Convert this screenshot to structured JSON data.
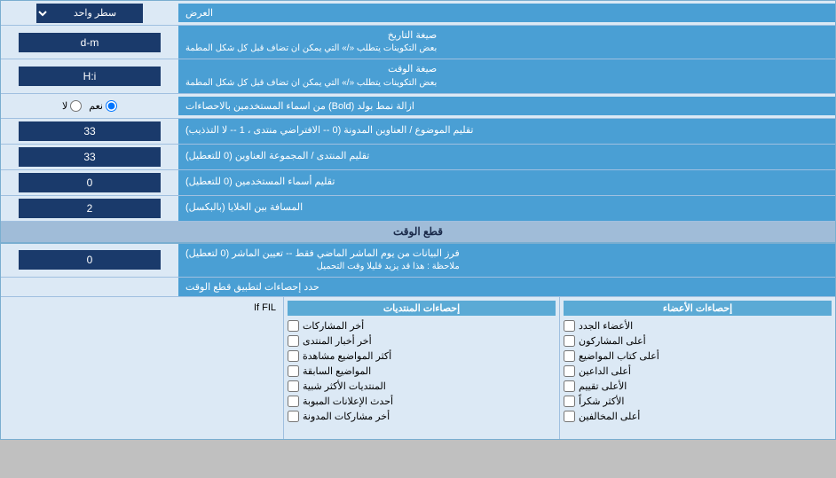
{
  "page": {
    "title": "العرض",
    "rows": [
      {
        "id": "display_mode",
        "label": "العرض",
        "control_type": "dropdown",
        "value": "سطر واحد"
      },
      {
        "id": "date_format",
        "label": "صيغة التاريخ\nبعض التكوينات يتطلب «/» التي يمكن ان تضاف قبل كل شكل المطمة",
        "control_type": "input",
        "value": "d-m"
      },
      {
        "id": "time_format",
        "label": "صيغة الوقت\nبعض التكوينات يتطلب «/» التي يمكن ان تضاف قبل كل شكل المطمة",
        "control_type": "input",
        "value": "H:i"
      },
      {
        "id": "bold_remove",
        "label": "ازالة نمط بولد (Bold) من اسماء المستخدمين بالاحصاءات",
        "control_type": "radio",
        "options": [
          "نعم",
          "لا"
        ],
        "selected": "نعم"
      },
      {
        "id": "topic_title_trim",
        "label": "تقليم الموضوع / العناوين المدونة (0 -- الافتراضي منتدى ، 1 -- لا التذذيب)",
        "control_type": "input",
        "value": "33"
      },
      {
        "id": "forum_title_trim",
        "label": "تقليم المنتدى / المجموعة العناوين (0 للتعطيل)",
        "control_type": "input",
        "value": "33"
      },
      {
        "id": "username_trim",
        "label": "تقليم أسماء المستخدمين (0 للتعطيل)",
        "control_type": "input",
        "value": "0"
      },
      {
        "id": "cell_spacing",
        "label": "المسافة بين الخلايا (بالبكسل)",
        "control_type": "input",
        "value": "2"
      }
    ],
    "section_cutoff": {
      "title": "قطع الوقت",
      "rows": [
        {
          "id": "cutoff_days",
          "label": "فرز البيانات من يوم الماشر الماضي فقط -- تعيين الماشر (0 لتعطيل)\nملاحظة : هذا قد يزيد قليلا وقت التحميل",
          "control_type": "input",
          "value": "0"
        }
      ]
    },
    "checkboxes_section": {
      "label": "حدد إحصاءات لتطبيق قطع الوقت",
      "column1": {
        "title": "إحصاءات الأعضاء",
        "items": [
          {
            "id": "new_members",
            "label": "الأعضاء الجدد",
            "checked": false
          },
          {
            "id": "top_posters",
            "label": "أعلى المشاركون",
            "checked": false
          },
          {
            "id": "top_authors",
            "label": "أعلى كتاب المواضيع",
            "checked": false
          },
          {
            "id": "top_visitors",
            "label": "أعلى الداعين",
            "checked": false
          },
          {
            "id": "top_raters",
            "label": "الأعلى تقييم",
            "checked": false
          },
          {
            "id": "top_thanked",
            "label": "الأكثر شكراً",
            "checked": false
          },
          {
            "id": "top_moderators",
            "label": "أعلى المخالفين",
            "checked": false
          }
        ]
      },
      "column2": {
        "title": "إحصاءات المنتديات",
        "items": [
          {
            "id": "recent_posts",
            "label": "أخر المشاركات",
            "checked": false
          },
          {
            "id": "latest_news",
            "label": "أخر أخبار المنتدى",
            "checked": false
          },
          {
            "id": "most_viewed",
            "label": "أكثر المواضيع مشاهدة",
            "checked": false
          },
          {
            "id": "recent_topics",
            "label": "المواضيع السابقة",
            "checked": false
          },
          {
            "id": "similar_forums",
            "label": "المنتديات الأكثر شبية",
            "checked": false
          },
          {
            "id": "recent_ads",
            "label": "أحدث الإعلانات المبوبة",
            "checked": false
          },
          {
            "id": "recent_collab",
            "label": "أخر مشاركات المدونة",
            "checked": false
          }
        ]
      },
      "column3": {
        "title": "",
        "note": "If FIL"
      }
    }
  }
}
